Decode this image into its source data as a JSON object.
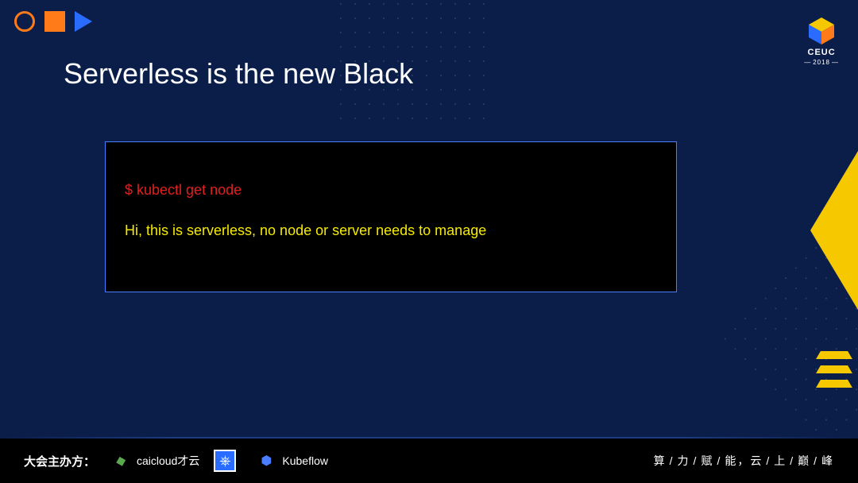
{
  "header": {
    "title": "Serverless is the new Black"
  },
  "logo": {
    "name": "CEUC",
    "year": "2018"
  },
  "terminal": {
    "command": "$ kubectl get node",
    "output": "Hi, this is serverless, no node or server needs to manage"
  },
  "footer": {
    "organizer_label": "大会主办方：",
    "sponsors": [
      {
        "name": "caicloud才云"
      },
      {
        "name": ""
      },
      {
        "name": "Kubeflow"
      }
    ],
    "slogan_chars": [
      "算",
      "力",
      "赋",
      "能",
      "，",
      "云",
      "上",
      "巅",
      "峰"
    ]
  }
}
